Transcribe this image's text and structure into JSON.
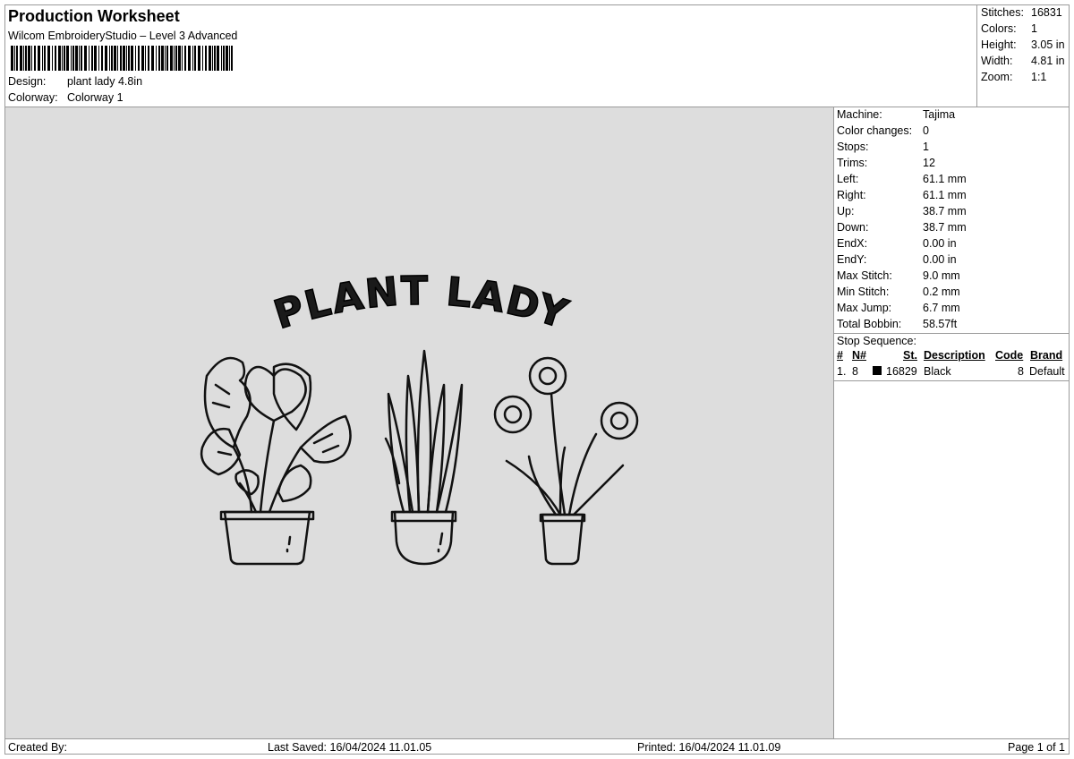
{
  "header": {
    "title": "Production Worksheet",
    "software": "Wilcom EmbroideryStudio – Level 3 Advanced",
    "design_label": "Design:",
    "design_value": "plant lady 4.8in",
    "colorway_label": "Colorway:",
    "colorway_value": "Colorway 1"
  },
  "summary": {
    "stitches_label": "Stitches:",
    "stitches_value": "16831",
    "colors_label": "Colors:",
    "colors_value": "1",
    "height_label": "Height:",
    "height_value": "3.05 in",
    "width_label": "Width:",
    "width_value": "4.81 in",
    "zoom_label": "Zoom:",
    "zoom_value": "1:1"
  },
  "design_text": "PLANT LADY",
  "details": [
    {
      "label": "Machine:",
      "value": "Tajima"
    },
    {
      "label": "Color changes:",
      "value": "0"
    },
    {
      "label": "Stops:",
      "value": "1"
    },
    {
      "label": "Trims:",
      "value": "12"
    },
    {
      "label": "Left:",
      "value": "61.1 mm"
    },
    {
      "label": "Right:",
      "value": "61.1 mm"
    },
    {
      "label": "Up:",
      "value": "38.7 mm"
    },
    {
      "label": "Down:",
      "value": "38.7 mm"
    },
    {
      "label": "EndX:",
      "value": "0.00 in"
    },
    {
      "label": "EndY:",
      "value": "0.00 in"
    },
    {
      "label": "Max Stitch:",
      "value": "9.0 mm"
    },
    {
      "label": "Min Stitch:",
      "value": "0.2 mm"
    },
    {
      "label": "Max Jump:",
      "value": "6.7 mm"
    },
    {
      "label": "Total Bobbin:",
      "value": "58.57ft"
    }
  ],
  "stop_sequence": {
    "title": "Stop Sequence:",
    "headers": {
      "num": "#",
      "n": "N#",
      "st": "St.",
      "desc": "Description",
      "code": "Code",
      "brand": "Brand"
    },
    "rows": [
      {
        "num": "1.",
        "n": "8",
        "color": "#000000",
        "st": "16829",
        "desc": "Black",
        "code": "8",
        "brand": "Default"
      }
    ]
  },
  "footer": {
    "created_by": "Created By:",
    "last_saved": "Last Saved: 16/04/2024 11.01.05",
    "printed": "Printed: 16/04/2024 11.01.09",
    "page": "Page 1 of 1"
  }
}
